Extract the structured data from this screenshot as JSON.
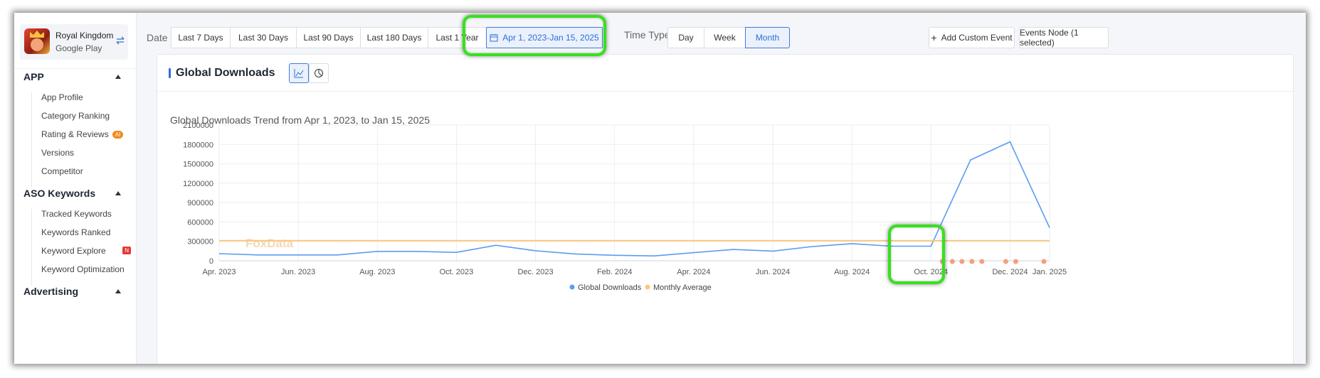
{
  "app": {
    "name": "Royal Kingdom",
    "store": "Google Play",
    "swap_icon": "swap-icon"
  },
  "sidebar": {
    "sections": [
      {
        "title": "APP",
        "items": [
          {
            "label": "App Profile",
            "badge": ""
          },
          {
            "label": "Category Ranking",
            "badge": ""
          },
          {
            "label": "Rating & Reviews",
            "badge": "AI"
          },
          {
            "label": "Versions",
            "badge": ""
          },
          {
            "label": "Competitor",
            "badge": ""
          }
        ]
      },
      {
        "title": "ASO Keywords",
        "items": [
          {
            "label": "Tracked Keywords",
            "badge": ""
          },
          {
            "label": "Keywords Ranked",
            "badge": ""
          },
          {
            "label": "Keyword Explore",
            "badge": "N"
          },
          {
            "label": "Keyword Optimization",
            "badge": ""
          }
        ]
      },
      {
        "title": "Advertising",
        "items": []
      }
    ]
  },
  "toolbar": {
    "date_label": "Date",
    "date_ranges": [
      "Last 7 Days",
      "Last 30 Days",
      "Last 90 Days",
      "Last 180 Days",
      "Last 1 Year"
    ],
    "custom_range": "Apr 1, 2023-Jan 15, 2025",
    "time_type_label": "Time Type",
    "time_types": [
      "Day",
      "Week",
      "Month"
    ],
    "time_type_selected": "Month",
    "add_event": "Add Custom Event",
    "events_node": "Events Node (1 selected)"
  },
  "card": {
    "title": "Global Downloads"
  },
  "colors": {
    "accent": "#2f6fd2",
    "line": "#5b9cf0",
    "average": "#fbc67a",
    "event_dot": "#f4a07c",
    "highlight": "#35e21b"
  },
  "chart_data": {
    "type": "line",
    "title": "Global Downloads Trend from Apr 1, 2023, to Jan 15, 2025",
    "x": [
      "Apr. 2023",
      "May 2023",
      "Jun. 2023",
      "Jul. 2023",
      "Aug. 2023",
      "Sep. 2023",
      "Oct. 2023",
      "Nov. 2023",
      "Dec. 2023",
      "Jan. 2024",
      "Feb. 2024",
      "Mar. 2024",
      "Apr. 2024",
      "May 2024",
      "Jun. 2024",
      "Jul. 2024",
      "Aug. 2024",
      "Sep. 2024",
      "Oct. 2024",
      "Nov. 2024",
      "Dec. 2024",
      "Jan. 2025"
    ],
    "x_tick_labels": [
      "Apr. 2023",
      "Jun. 2023",
      "Aug. 2023",
      "Oct. 2023",
      "Dec. 2023",
      "Feb. 2024",
      "Apr. 2024",
      "Jun. 2024",
      "Aug. 2024",
      "Oct. 2024",
      "Dec. 2024",
      "Jan. 2025"
    ],
    "series": [
      {
        "name": "Global Downloads",
        "values": [
          110000,
          90000,
          90000,
          90000,
          145000,
          145000,
          130000,
          240000,
          155000,
          105000,
          85000,
          75000,
          125000,
          175000,
          150000,
          220000,
          265000,
          225000,
          225000,
          1560000,
          1840000,
          510000
        ]
      },
      {
        "name": "Monthly Average",
        "values": [
          310000,
          310000,
          310000,
          310000,
          310000,
          310000,
          310000,
          310000,
          310000,
          310000,
          310000,
          310000,
          310000,
          310000,
          310000,
          310000,
          310000,
          310000,
          310000,
          310000,
          310000,
          310000
        ]
      }
    ],
    "y_ticks": [
      0,
      300000,
      600000,
      900000,
      1200000,
      1500000,
      1800000,
      2100000
    ],
    "ylim": [
      0,
      2100000
    ],
    "event_markers": [
      "Oct. 2024",
      "Oct. 2024",
      "Nov. 2024",
      "Nov. 2024",
      "Nov. 2024",
      "Dec. 2024",
      "Dec. 2024",
      "Jan. 2025"
    ],
    "watermark": "FoxData",
    "legend": "bottom-center",
    "grid": true
  }
}
